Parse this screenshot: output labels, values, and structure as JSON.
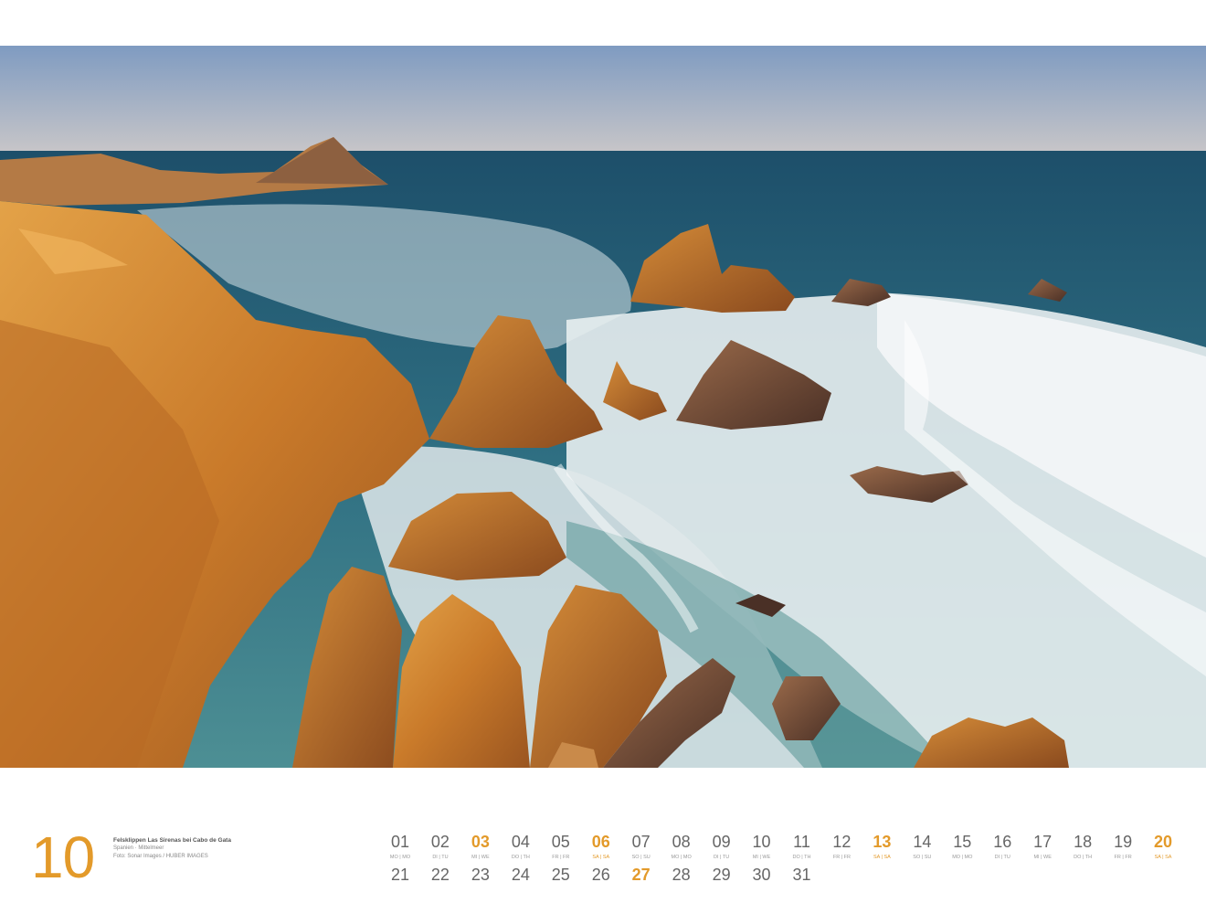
{
  "month": {
    "number": "10"
  },
  "caption": {
    "title": "Felsklippen Las Sirenas bei Cabo de Gata",
    "location": "Spanien · Mittelmeer",
    "credit": "Foto: Sonar Images / HUBER IMAGES"
  },
  "photo": {
    "subject": "coastal-rocks-photo"
  },
  "colors": {
    "accent": "#e39a2a",
    "day_text": "#666666",
    "weekday_text": "#999999"
  },
  "days": [
    {
      "num": "01",
      "wd": "MO | MO",
      "highlight": false
    },
    {
      "num": "02",
      "wd": "DI | TU",
      "highlight": false
    },
    {
      "num": "03",
      "wd": "MI | WE",
      "highlight": true
    },
    {
      "num": "04",
      "wd": "DO | TH",
      "highlight": false
    },
    {
      "num": "05",
      "wd": "FR | FR",
      "highlight": false
    },
    {
      "num": "06",
      "wd": "SA | SA",
      "highlight": true
    },
    {
      "num": "07",
      "wd": "SO | SU",
      "highlight": false
    },
    {
      "num": "08",
      "wd": "MO | MO",
      "highlight": false
    },
    {
      "num": "09",
      "wd": "DI | TU",
      "highlight": false
    },
    {
      "num": "10",
      "wd": "MI | WE",
      "highlight": false
    },
    {
      "num": "11",
      "wd": "DO | TH",
      "highlight": false
    },
    {
      "num": "12",
      "wd": "FR | FR",
      "highlight": false
    },
    {
      "num": "13",
      "wd": "SA | SA",
      "highlight": true
    },
    {
      "num": "14",
      "wd": "SO | SU",
      "highlight": false
    },
    {
      "num": "15",
      "wd": "MO | MO",
      "highlight": false
    },
    {
      "num": "16",
      "wd": "DI | TU",
      "highlight": false
    },
    {
      "num": "17",
      "wd": "MI | WE",
      "highlight": false
    },
    {
      "num": "18",
      "wd": "DO | TH",
      "highlight": false
    },
    {
      "num": "19",
      "wd": "FR | FR",
      "highlight": false
    },
    {
      "num": "20",
      "wd": "SA | SA",
      "highlight": true
    },
    {
      "num": "21",
      "wd": "",
      "highlight": false
    },
    {
      "num": "22",
      "wd": "",
      "highlight": false
    },
    {
      "num": "23",
      "wd": "",
      "highlight": false
    },
    {
      "num": "24",
      "wd": "",
      "highlight": false
    },
    {
      "num": "25",
      "wd": "",
      "highlight": false
    },
    {
      "num": "26",
      "wd": "",
      "highlight": false
    },
    {
      "num": "27",
      "wd": "",
      "highlight": true
    },
    {
      "num": "28",
      "wd": "",
      "highlight": false
    },
    {
      "num": "29",
      "wd": "",
      "highlight": false
    },
    {
      "num": "30",
      "wd": "",
      "highlight": false
    },
    {
      "num": "31",
      "wd": "",
      "highlight": false
    }
  ]
}
